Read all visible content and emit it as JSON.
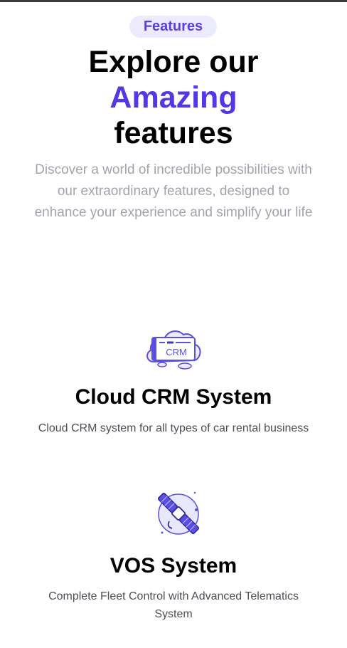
{
  "badge": "Features",
  "headline": {
    "line1": "Explore our",
    "accent": "Amazing",
    "line3": "features"
  },
  "intro": "Discover a world of incredible possibilities with our extraordinary features, designed to enhance your experience and simplify your life",
  "colors": {
    "accent": "#5637e6",
    "badge_bg": "#ecebfd",
    "muted_text": "#a3a3ad",
    "body_text": "#4e4e56"
  },
  "features": [
    {
      "icon": "cloud-crm-icon",
      "icon_text": "CRM",
      "title": "Cloud CRM System",
      "description": "Cloud CRM system for all types of car rental business"
    },
    {
      "icon": "satellite-icon",
      "title": "VOS System",
      "description": "Complete Fleet Control with Advanced Telematics System"
    }
  ]
}
